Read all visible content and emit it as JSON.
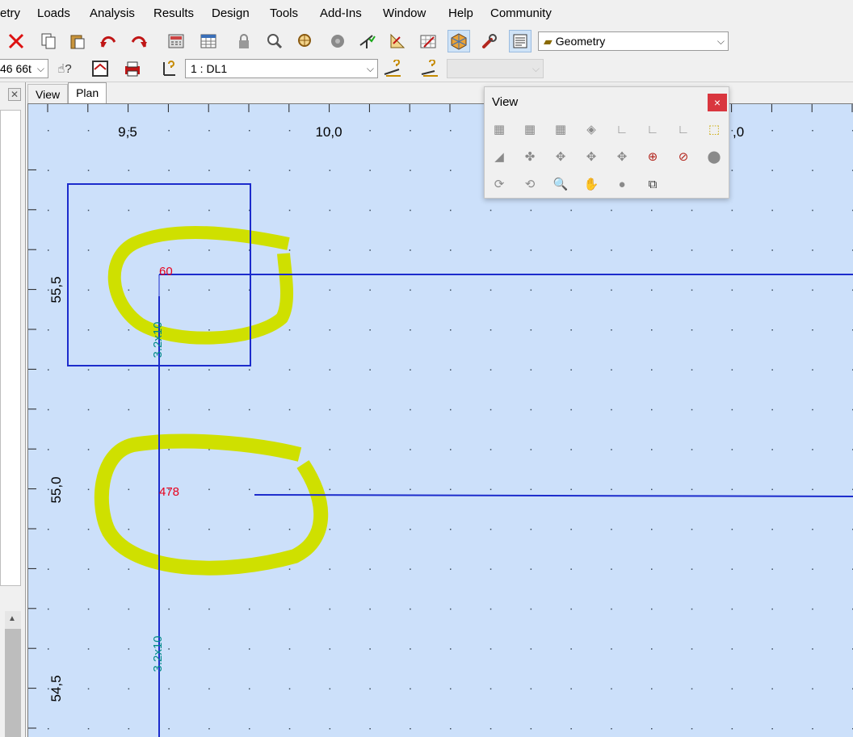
{
  "menu": {
    "items": [
      "etry",
      "Loads",
      "Analysis",
      "Results",
      "Design",
      "Tools",
      "Add-Ins",
      "Window",
      "Help",
      "Community"
    ]
  },
  "toolbar1": {
    "geometry_combo": "Geometry"
  },
  "toolbar2": {
    "units_combo": "46 66t",
    "loadcase_combo": "1 : DL1",
    "disabled_combo": ""
  },
  "left_panel": {
    "close_glyph": "✕"
  },
  "tabs": {
    "view": "View",
    "plan": "Plan"
  },
  "plan": {
    "x_ticks": [
      "9,5",
      "10,0",
      ",0"
    ],
    "y_ticks": [
      "55,5",
      "55,0",
      "54,5"
    ],
    "node_labels": [
      "60",
      "478"
    ],
    "member_labels": [
      "3.2x10",
      "3.2x10"
    ],
    "colors": {
      "background": "#cce0fa",
      "member": "#1c2ccc",
      "node_label": "#e8001c",
      "section_label": "#008a8a",
      "highlight": "#cfe000"
    }
  },
  "view_panel": {
    "title": "View",
    "close_glyph": "×",
    "icons": [
      "view-x-icon",
      "view-y-icon",
      "view-z-icon",
      "view-iso-icon",
      "axis-xy-icon",
      "axis-yz-icon",
      "axis-xz-icon",
      "box-3d-icon",
      "perspective-icon",
      "rotate-iso-icon",
      "rotate-x-icon",
      "rotate-y-icon",
      "rotate-z-icon",
      "zoom-window-icon",
      "zoom-dynamic-icon",
      "pan-sphere-icon",
      "rotate-cw-icon",
      "rotate-ccw-icon",
      "zoom-in-icon",
      "pan-hand-icon",
      "shade-icon",
      "window-stack-icon"
    ]
  }
}
